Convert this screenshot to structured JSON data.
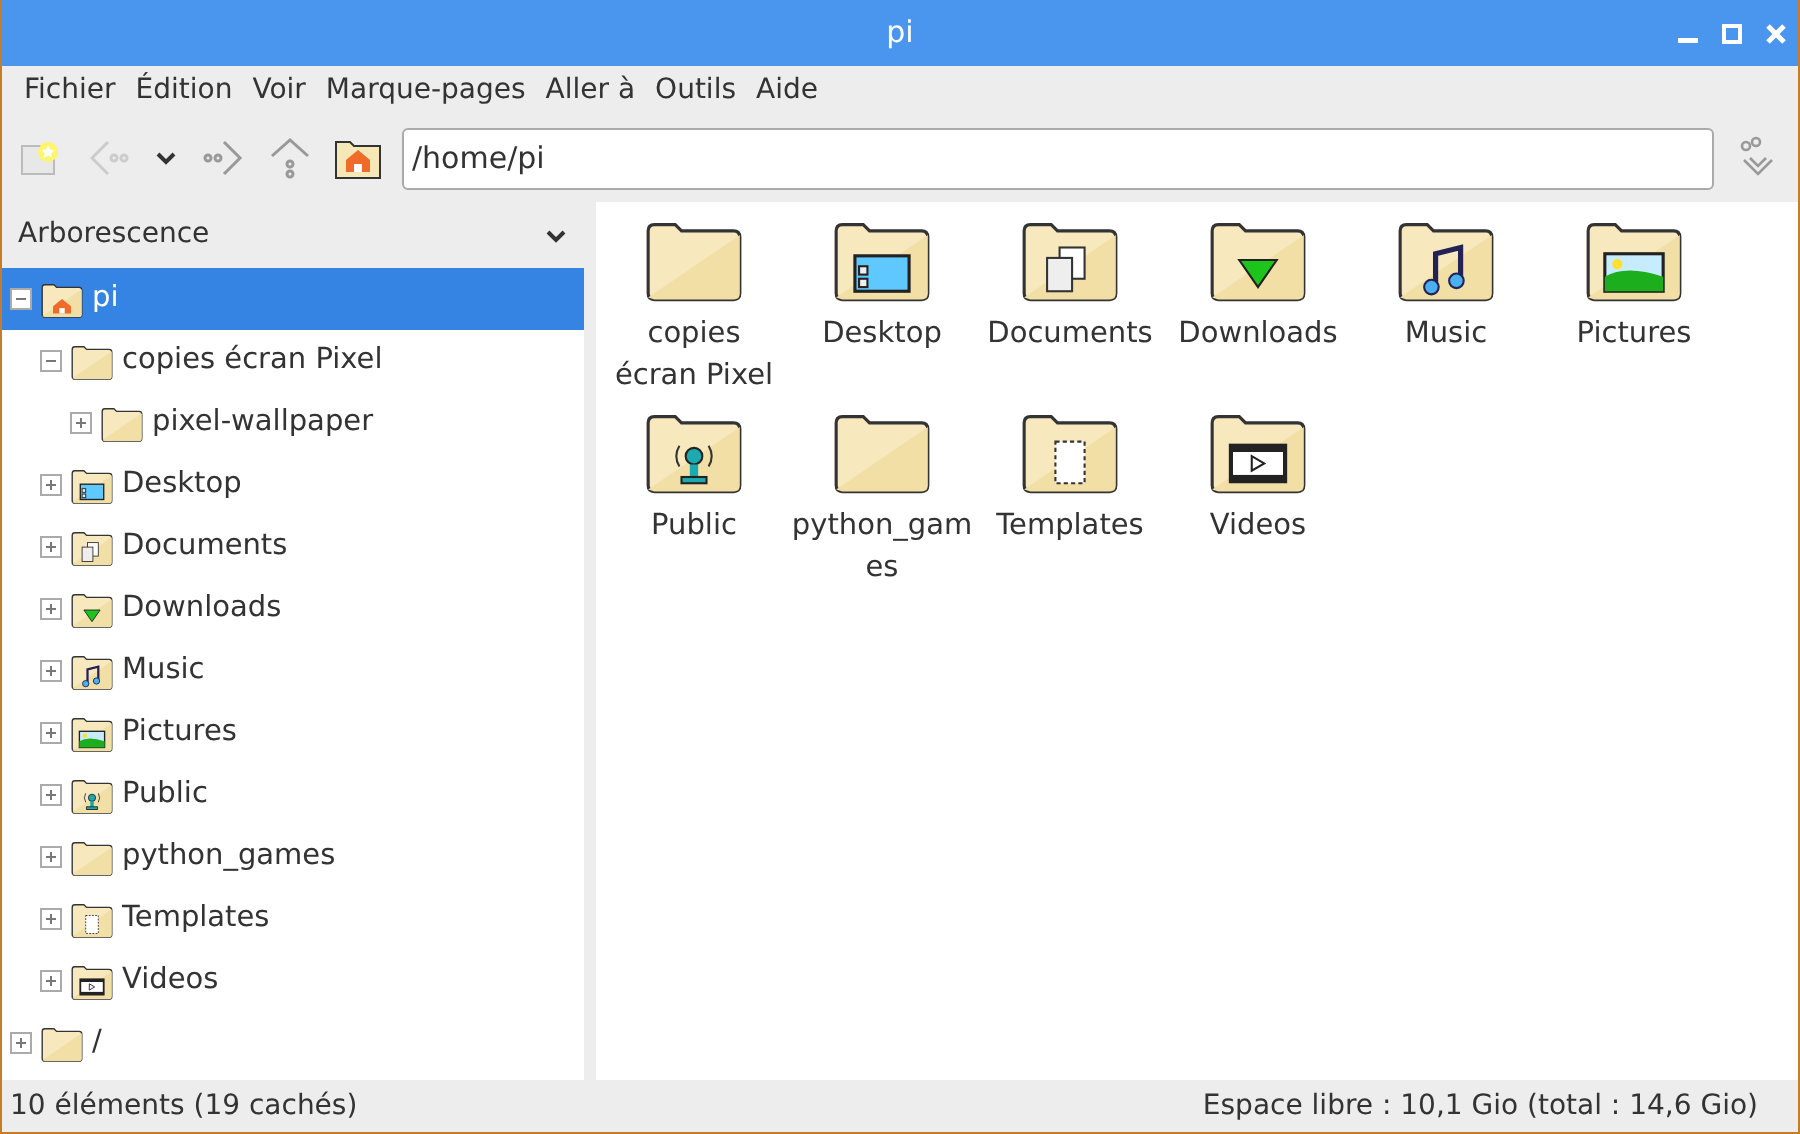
{
  "window": {
    "title": "pi"
  },
  "menu": [
    "Fichier",
    "Édition",
    "Voir",
    "Marque-pages",
    "Aller à",
    "Outils",
    "Aide"
  ],
  "location": {
    "value": "/home/pi"
  },
  "sidebar": {
    "title": "Arborescence",
    "tree": [
      {
        "label": "pi",
        "kind": "home",
        "expanded": true,
        "selected": true,
        "children": [
          {
            "label": "copies écran Pixel",
            "kind": "plain",
            "expanded": true,
            "selected": false,
            "children": [
              {
                "label": "pixel-wallpaper",
                "kind": "plain",
                "expanded": false,
                "selected": false
              }
            ]
          },
          {
            "label": "Desktop",
            "kind": "desktop",
            "expanded": false,
            "selected": false
          },
          {
            "label": "Documents",
            "kind": "documents",
            "expanded": false,
            "selected": false
          },
          {
            "label": "Downloads",
            "kind": "downloads",
            "expanded": false,
            "selected": false
          },
          {
            "label": "Music",
            "kind": "music",
            "expanded": false,
            "selected": false
          },
          {
            "label": "Pictures",
            "kind": "pictures",
            "expanded": false,
            "selected": false
          },
          {
            "label": "Public",
            "kind": "public",
            "expanded": false,
            "selected": false
          },
          {
            "label": "python_games",
            "kind": "plain",
            "expanded": false,
            "selected": false
          },
          {
            "label": "Templates",
            "kind": "templates",
            "expanded": false,
            "selected": false
          },
          {
            "label": "Videos",
            "kind": "videos",
            "expanded": false,
            "selected": false
          }
        ]
      },
      {
        "label": "/",
        "kind": "plain",
        "expanded": false,
        "selected": false
      }
    ]
  },
  "files": [
    {
      "label": "copies écran Pixel",
      "kind": "plain"
    },
    {
      "label": "Desktop",
      "kind": "desktop"
    },
    {
      "label": "Documents",
      "kind": "documents"
    },
    {
      "label": "Downloads",
      "kind": "downloads"
    },
    {
      "label": "Music",
      "kind": "music"
    },
    {
      "label": "Pictures",
      "kind": "pictures"
    },
    {
      "label": "Public",
      "kind": "public"
    },
    {
      "label": "python_games",
      "kind": "plain"
    },
    {
      "label": "Templates",
      "kind": "templates"
    },
    {
      "label": "Videos",
      "kind": "videos"
    }
  ],
  "status_bar": {
    "left": "10 éléments (19 cachés)",
    "right": "Espace libre : 10,1 Gio (total : 14,6 Gio)"
  }
}
